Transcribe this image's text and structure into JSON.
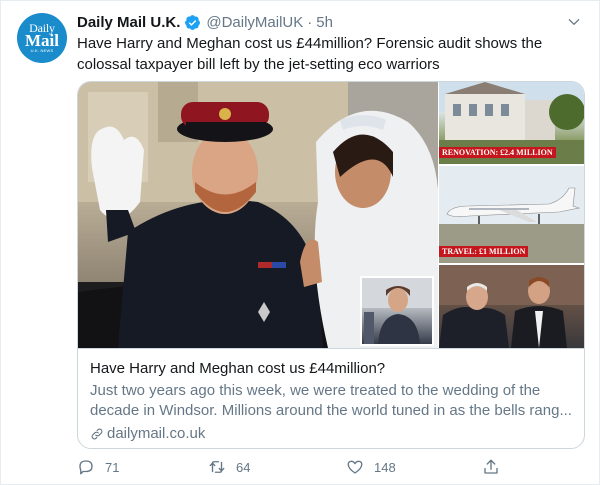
{
  "tweet": {
    "display_name": "Daily Mail U.K.",
    "handle": "@DailyMailUK",
    "separator": "·",
    "timestamp": "5h",
    "text": "Have Harry and Meghan cost us £44million? Forensic audit shows the colossal taxpayer bill left by the jet-setting eco warriors",
    "avatar": {
      "line1": "Daily",
      "line2": "Mail",
      "line3": "U.K. NEWS",
      "color": "#1a8ccc"
    },
    "verified_color": "#1da1f2"
  },
  "card": {
    "image_labels": [
      "RENOVATION: £2.4 MILLION",
      "TRAVEL: £1 MILLION"
    ],
    "label_color": "#c4161c",
    "title": "Have Harry and Meghan cost us £44million?",
    "description": "Just two years ago this week, we were treated to the wedding of the decade in Windsor. Millions around the world tuned in as the bells rang...",
    "domain": "dailymail.co.uk"
  },
  "actions": {
    "reply_count": "71",
    "retweet_count": "64",
    "like_count": "148"
  },
  "icons": [
    "verified-icon",
    "caret-down-icon",
    "link-icon",
    "reply-icon",
    "retweet-icon",
    "like-icon",
    "share-icon"
  ]
}
